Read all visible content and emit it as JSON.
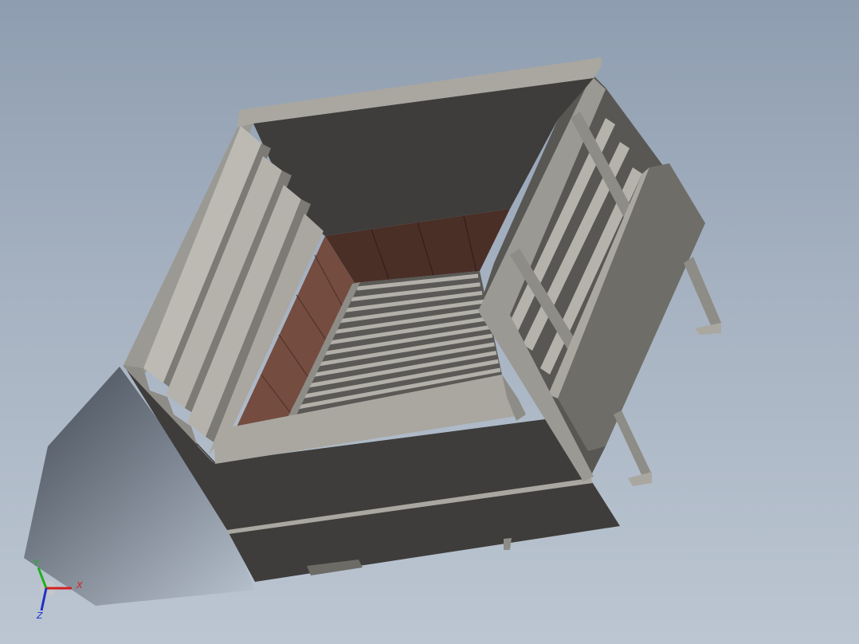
{
  "viewport": {
    "background_top": "#8e9db0",
    "background_bottom": "#bcc6d2"
  },
  "model": {
    "colors": {
      "steel_light": "#a9a7a0",
      "steel_mid": "#8e8c86",
      "steel_dark": "#3e3d3b",
      "brick_wall": "#744c40",
      "brick_back": "#4a2f27"
    }
  },
  "triad": {
    "x_label": "X",
    "y_label": "Y",
    "z_label": "Z",
    "x_color": "#d42020",
    "y_color": "#1fb01f",
    "z_color": "#2030c8"
  }
}
